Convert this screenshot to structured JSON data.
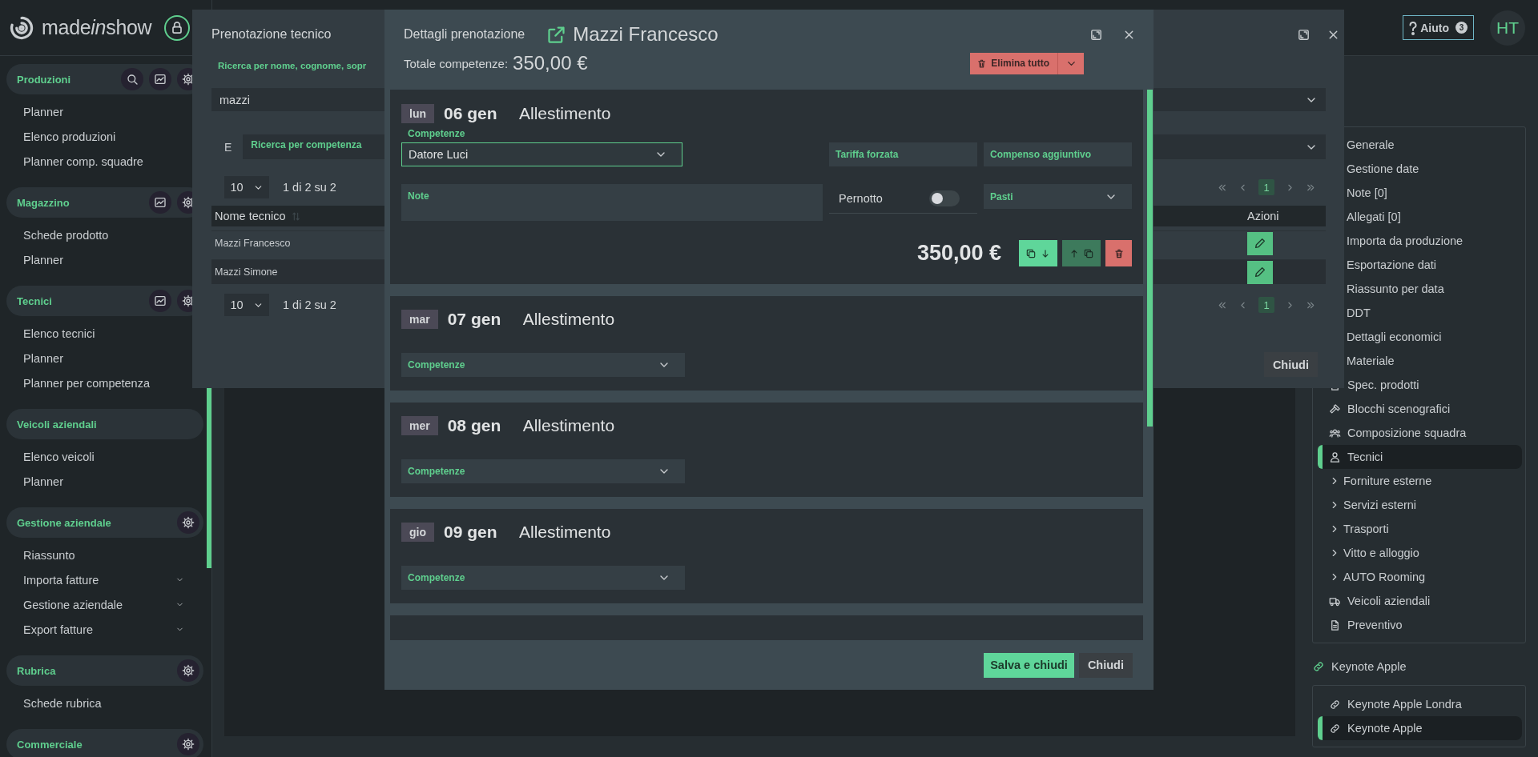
{
  "header": {
    "logo": [
      "made",
      "in",
      "show"
    ],
    "help": {
      "label": "Aiuto",
      "badge": "3"
    },
    "avatar": "HT"
  },
  "sidebar": {
    "groups": [
      {
        "title": "Produzioni",
        "items": [
          {
            "label": "Planner",
            "has_submenu": false
          },
          {
            "label": "Elenco produzioni",
            "has_submenu": false
          },
          {
            "label": "Planner comp. squadre",
            "has_submenu": false
          }
        ]
      },
      {
        "title": "Magazzino",
        "items": [
          {
            "label": "Schede prodotto",
            "has_submenu": false
          },
          {
            "label": "Planner",
            "has_submenu": false
          }
        ]
      },
      {
        "title": "Tecnici",
        "items": [
          {
            "label": "Elenco tecnici",
            "has_submenu": false
          },
          {
            "label": "Planner",
            "has_submenu": false
          },
          {
            "label": "Planner per competenza",
            "has_submenu": false
          }
        ]
      },
      {
        "title": "Veicoli aziendali",
        "items": [
          {
            "label": "Elenco veicoli",
            "has_submenu": false
          },
          {
            "label": "Planner",
            "has_submenu": false
          }
        ]
      },
      {
        "title": "Gestione aziendale",
        "items": [
          {
            "label": "Riassunto",
            "has_submenu": false
          },
          {
            "label": "Importa fatture",
            "has_submenu": true
          },
          {
            "label": "Gestione aziendale",
            "has_submenu": true
          },
          {
            "label": "Export fatture",
            "has_submenu": true
          }
        ]
      },
      {
        "title": "Rubrica",
        "items": [
          {
            "label": "Schede rubrica",
            "has_submenu": false
          }
        ]
      },
      {
        "title": "Commerciale"
      }
    ]
  },
  "right_panel": {
    "nav": [
      {
        "label": "Generale",
        "expandable": false,
        "selected": false
      },
      {
        "label": "Gestione date",
        "expandable": false,
        "selected": false
      },
      {
        "label": "Note [0]",
        "expandable": false,
        "selected": false
      },
      {
        "label": "Allegati [0]",
        "expandable": false,
        "selected": false
      },
      {
        "label": "Importa da produzione",
        "expandable": false,
        "selected": false
      },
      {
        "label": "Esportazione dati",
        "expandable": false,
        "selected": false
      },
      {
        "label": "Riassunto per data",
        "expandable": false,
        "selected": false
      },
      {
        "label": "DDT",
        "expandable": false,
        "selected": false
      },
      {
        "label": "Dettagli economici",
        "expandable": false,
        "selected": false
      },
      {
        "label": "Materiale",
        "expandable": false,
        "selected": false
      },
      {
        "label": "Spec. prodotti",
        "expandable": false,
        "selected": false
      },
      {
        "label": "Blocchi scenografici",
        "expandable": false,
        "selected": false
      },
      {
        "label": "Composizione squadra",
        "expandable": false,
        "selected": false
      },
      {
        "label": "Tecnici",
        "expandable": false,
        "selected": true
      },
      {
        "label": "Forniture esterne",
        "expandable": true,
        "selected": false
      },
      {
        "label": "Servizi esterni",
        "expandable": true,
        "selected": false
      },
      {
        "label": "Trasporti",
        "expandable": true,
        "selected": false
      },
      {
        "label": "Vitto e alloggio",
        "expandable": true,
        "selected": false
      },
      {
        "label": "AUTO Rooming",
        "expandable": true,
        "selected": false
      },
      {
        "label": "Veicoli aziendali",
        "expandable": false,
        "selected": false
      },
      {
        "label": "Preventivo",
        "expandable": false,
        "selected": false
      }
    ],
    "project": "Keynote Apple",
    "related": [
      {
        "label": "Keynote Apple Londra",
        "selected": false
      },
      {
        "label": "Keynote Apple",
        "selected": true
      }
    ]
  },
  "booking_dialog": {
    "title": "Prenotazione tecnico",
    "search_label": "Ricerca per nome, cognome, sopr",
    "search_value": "mazzi",
    "operator": "E",
    "skill_placeholder": "Ricerca per competenza",
    "pagers": [
      {
        "page_size": "10",
        "info": "1 di 2 su 2",
        "pages": [
          {
            "label": "1",
            "selected": true
          }
        ]
      },
      {
        "page_size": "10",
        "info": "1 di 2 su 2",
        "pages": [
          {
            "label": "1",
            "selected": true
          }
        ]
      }
    ],
    "columns": [
      "Nome tecnico",
      "Azioni"
    ],
    "rows": [
      {
        "name": "Mazzi Francesco"
      },
      {
        "name": "Mazzi Simone"
      }
    ],
    "close_label": "Chiudi"
  },
  "details_dialog": {
    "title": "Dettagli prenotazione",
    "person": "Mazzi Francesco",
    "total_label": "Totale competenze:",
    "total_value": "350,00 €",
    "delete_all": "Elimina tutto",
    "days": [
      {
        "weekday": "lun",
        "date": "06 gen",
        "activity": "Allestimento",
        "expanded": true,
        "skill_label": "Competenze",
        "skill_value": "Datore Luci",
        "rate_label": "Tariffa forzata",
        "extra_label": "Compenso aggiuntivo",
        "note_label": "Note",
        "overnight_label": "Pernotto",
        "overnight": false,
        "meals_label": "Pasti",
        "amount": "350,00 €"
      },
      {
        "weekday": "mar",
        "date": "07 gen",
        "activity": "Allestimento",
        "expanded": false,
        "skill_label": "Competenze"
      },
      {
        "weekday": "mer",
        "date": "08 gen",
        "activity": "Allestimento",
        "expanded": false,
        "skill_label": "Competenze"
      },
      {
        "weekday": "gio",
        "date": "09 gen",
        "activity": "Allestimento",
        "expanded": false,
        "skill_label": "Competenze"
      }
    ],
    "save_label": "Salva e chiudi",
    "close_label": "Chiudi"
  }
}
